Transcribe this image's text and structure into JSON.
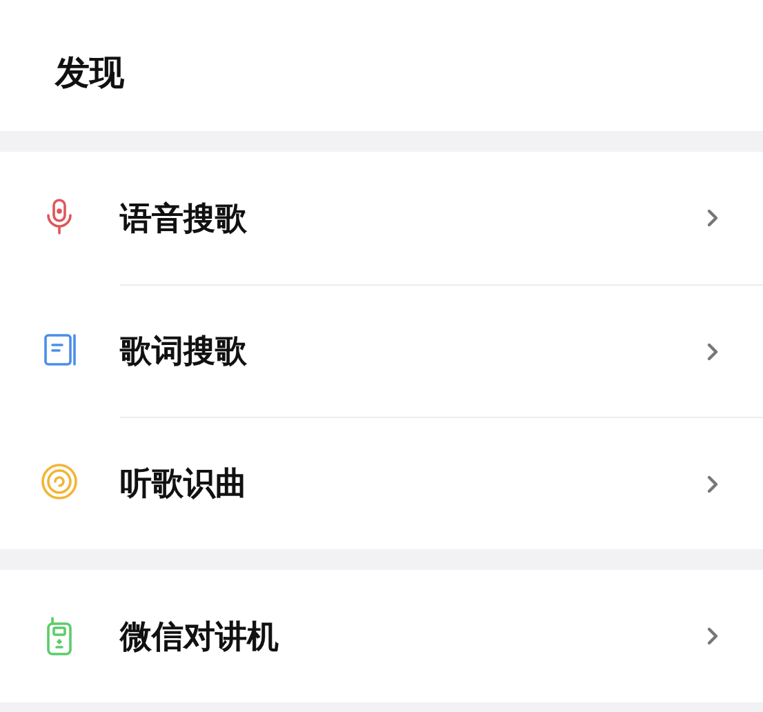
{
  "header": {
    "title": "发现"
  },
  "groups": [
    {
      "items": [
        {
          "kind": "mic",
          "label": "语音搜歌"
        },
        {
          "kind": "lyrics",
          "label": "歌词搜歌"
        },
        {
          "kind": "listen",
          "label": "听歌识曲"
        }
      ]
    },
    {
      "items": [
        {
          "kind": "walkie",
          "label": "微信对讲机"
        }
      ]
    }
  ]
}
